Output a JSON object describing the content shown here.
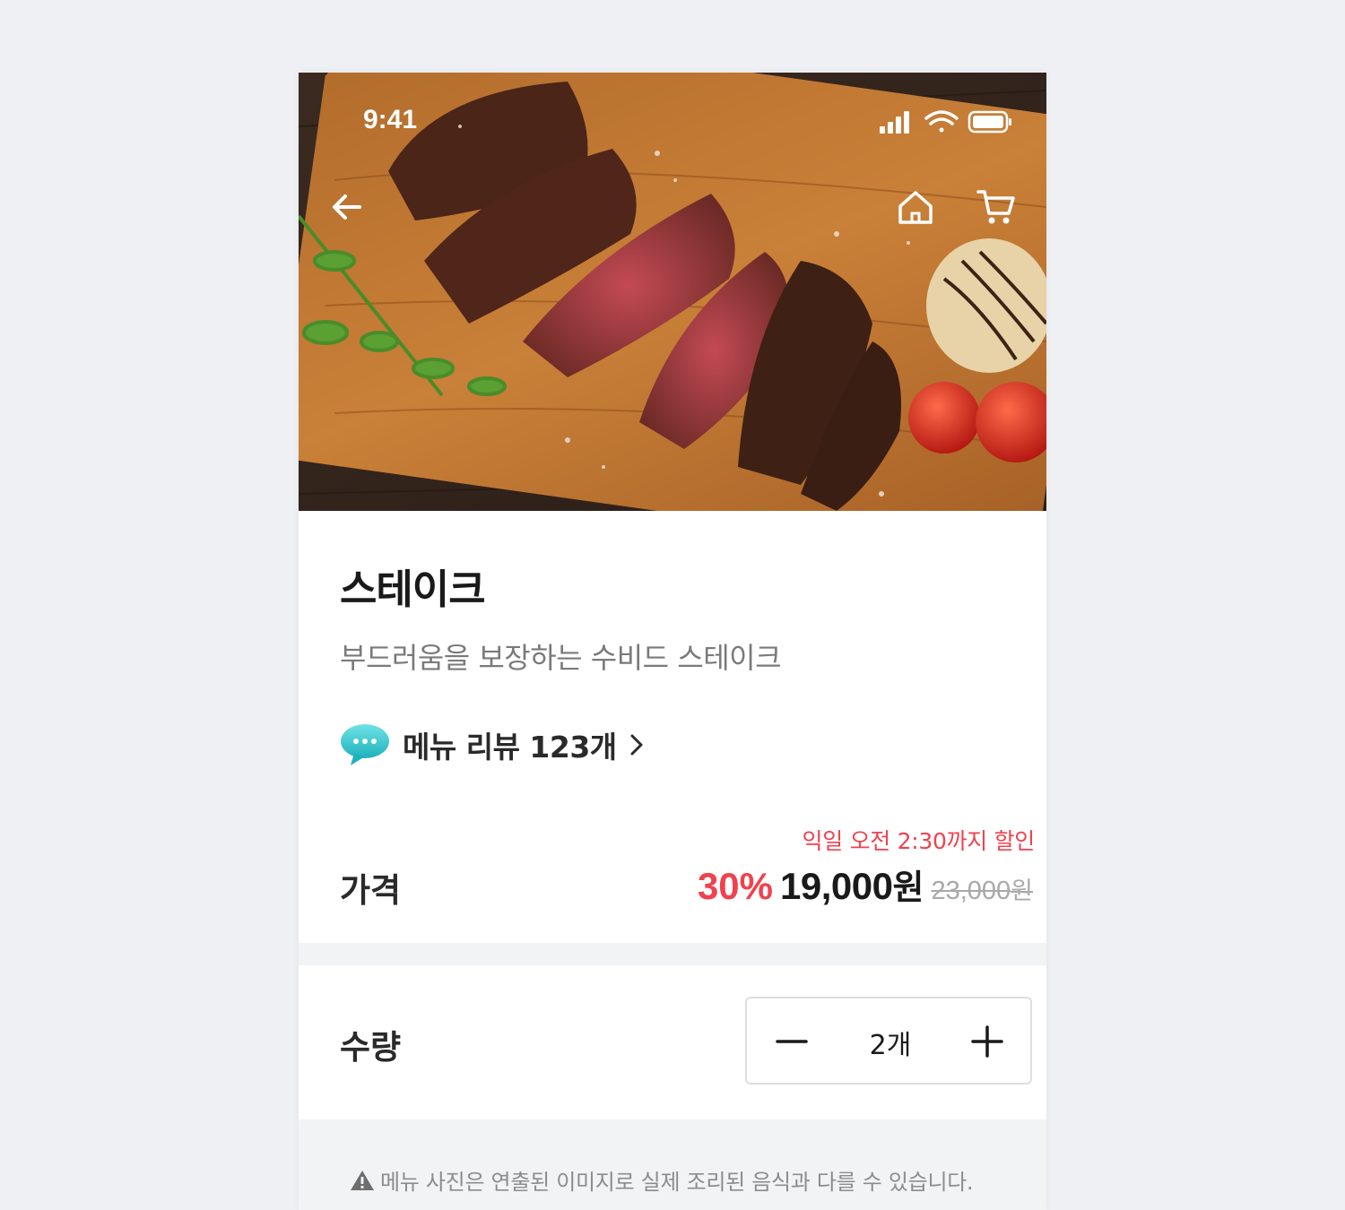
{
  "status_bar": {
    "time": "9:41",
    "signal_icon": "cellular-signal-icon",
    "wifi_icon": "wifi-icon",
    "battery_icon": "battery-icon"
  },
  "nav": {
    "back_icon": "arrow-left-icon",
    "home_icon": "home-icon",
    "cart_icon": "cart-icon"
  },
  "menu": {
    "name": "스테이크",
    "description": "부드러움을 보장하는 수비드 스테이크",
    "review_icon": "speech-bubble-icon",
    "review_link": "메뉴 리뷰 123개"
  },
  "price": {
    "label": "가격",
    "discount_note": "익일 오전 2:30까지 할인",
    "discount_rate": "30%",
    "sale_price": "19,000",
    "sale_unit": "원",
    "original_price": "23,000",
    "original_unit": "원"
  },
  "quantity": {
    "label": "수량",
    "value": "2개",
    "minus_icon": "minus-icon",
    "plus_icon": "plus-icon"
  },
  "notice": {
    "icon": "warning-icon",
    "text": "메뉴 사진은 연출된 이미지로 실제 조리된 음식과 다를 수 있습니다."
  },
  "colors": {
    "accent_red": "#f0424e",
    "text_dark": "#1a1a1a",
    "text_gray": "#7a7a7a",
    "background": "#eef0f4"
  }
}
